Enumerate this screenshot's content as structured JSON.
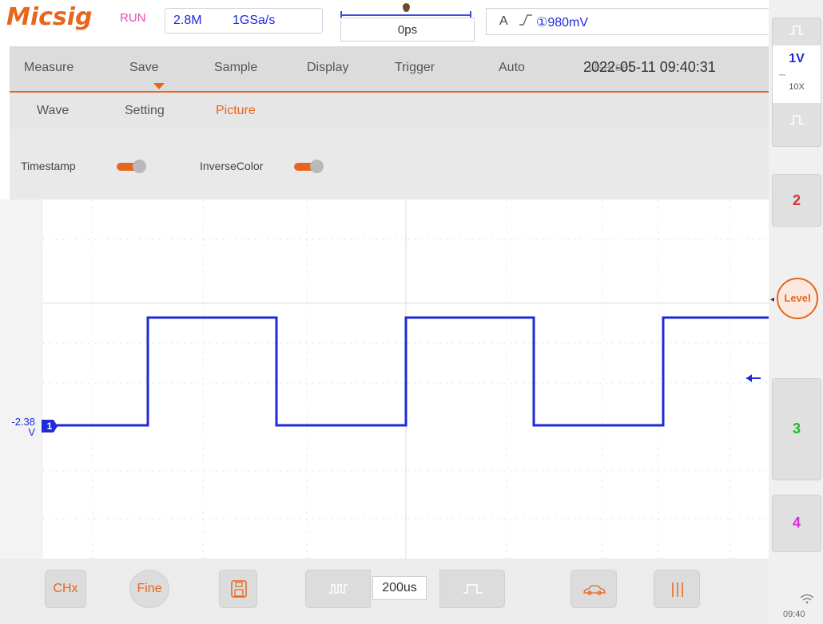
{
  "header": {
    "logo": "Micsig",
    "run_status": "RUN",
    "memory_depth": "2.8M",
    "sample_rate": "1GSa/s",
    "time_offset": "0ps",
    "trigger_source": "A",
    "trigger_edge": "⎍",
    "trigger_level": "①980mV"
  },
  "menu": {
    "items": [
      "Measure",
      "Save",
      "Sample",
      "Display",
      "Trigger",
      "Auto",
      "Userset"
    ],
    "active": "Save",
    "datetime": "2022-05-11 09:40:31"
  },
  "submenu": {
    "items": [
      "Wave",
      "Setting",
      "Picture"
    ],
    "active": "Picture"
  },
  "options": {
    "timestamp_label": "Timestamp",
    "timestamp_on": true,
    "inverse_label": "InverseColor",
    "inverse_on": true
  },
  "waveform": {
    "offset_label": "-2.38\nV",
    "offset_line1": "-2.38",
    "offset_line2": "V",
    "channel_marker": "1",
    "color": "#1f2ad9"
  },
  "sidebar": {
    "ch1_scale": "1V",
    "ch1_probe": "10X",
    "ch2_label": "2",
    "ch3_label": "3",
    "ch4_label": "4",
    "level_label": "Level",
    "ch2_color": "#d62f2f",
    "ch3_color": "#1fb92a",
    "ch4_color": "#d92fd9"
  },
  "bottom": {
    "chx_label": "CHx",
    "fine_label": "Fine",
    "timebase": "200us",
    "accent": "#e8651e"
  },
  "status": {
    "clock": "09:40"
  }
}
